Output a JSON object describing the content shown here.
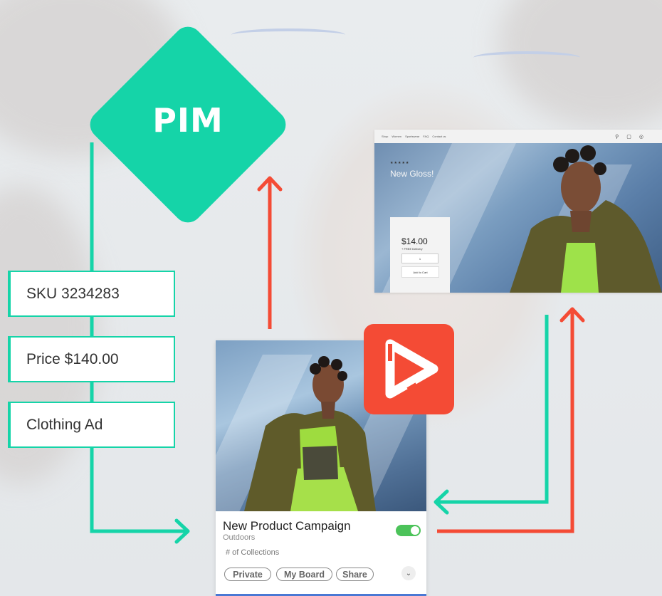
{
  "pim": {
    "label": "PIM"
  },
  "attributes": [
    {
      "label": "SKU 3234283"
    },
    {
      "label": "Price $140.00"
    },
    {
      "label": "Clothing Ad"
    }
  ],
  "website": {
    "nav": [
      "Shop",
      "Women",
      "Sportswear",
      "FAQ",
      "Contact us"
    ],
    "product_title": "New Gloss!",
    "price": "$14.00",
    "delivery": "+ FREE Delivery",
    "quantity": "1",
    "add_to_cart": "Add to Cart"
  },
  "card": {
    "title": "New Product Campaign",
    "subtitle": "Outdoors",
    "collections": "# of Collections",
    "toggle_on": true,
    "buttons": [
      "Private",
      "My Board",
      "Share"
    ]
  },
  "colors": {
    "pim_green": "#15d4a8",
    "arrow_red": "#f44b35",
    "brand_red": "#f44b35",
    "toggle_green": "#4cc35a"
  }
}
